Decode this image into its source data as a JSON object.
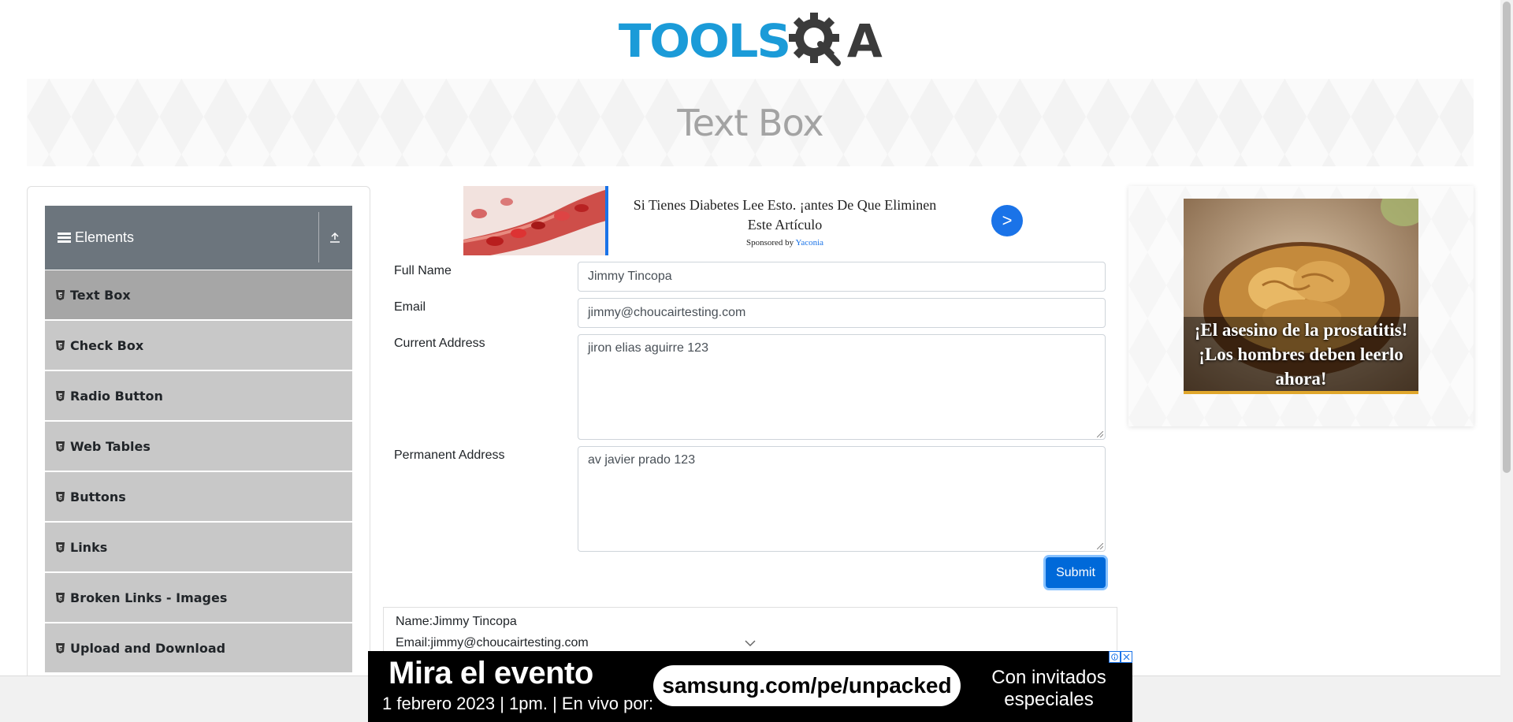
{
  "header": {
    "logo_tools": "TOOLS",
    "logo_a": "A",
    "page_title": "Text Box"
  },
  "sidebar": {
    "group_title": "Elements",
    "items": [
      {
        "label": "Text Box",
        "active": true
      },
      {
        "label": "Check Box"
      },
      {
        "label": "Radio Button"
      },
      {
        "label": "Web Tables"
      },
      {
        "label": "Buttons"
      },
      {
        "label": "Links"
      },
      {
        "label": "Broken Links - Images"
      },
      {
        "label": "Upload and Download"
      }
    ]
  },
  "ad_top": {
    "text": "Si Tienes Diabetes Lee Esto. ¡antes De Que Eliminen Este Artículo",
    "sponsored_prefix": "Sponsored by",
    "sponsor": "Yaconia",
    "go_label": ">"
  },
  "form": {
    "full_name_label": "Full Name",
    "full_name_value": "Jimmy Tincopa",
    "email_label": "Email",
    "email_value": "jimmy@choucairtesting.com",
    "current_address_label": "Current Address",
    "current_address_value": "jiron elias aguirre 123",
    "permanent_address_label": "Permanent Address",
    "permanent_address_value": "av javier prado 123",
    "submit_label": "Submit"
  },
  "output": {
    "name_line": "Name:Jimmy Tincopa",
    "email_line": "Email:jimmy@choucairtesting.com"
  },
  "ad_right": {
    "caption": "¡El asesino de la prostatitis! ¡Los hombres deben leerlo ahora!"
  },
  "ad_bottom": {
    "title": "Mira el evento",
    "date": "1 febrero 2023 | 1pm. | En vivo por:",
    "url": "samsung.com/pe/unpacked",
    "right_text": "Con invitados especiales"
  },
  "colors": {
    "brand_blue": "#1b9bd8",
    "sidebar_header": "#6c757d",
    "menu_item": "#c8c8c8",
    "menu_item_active": "#a6a6a6",
    "submit": "#0069d9"
  }
}
